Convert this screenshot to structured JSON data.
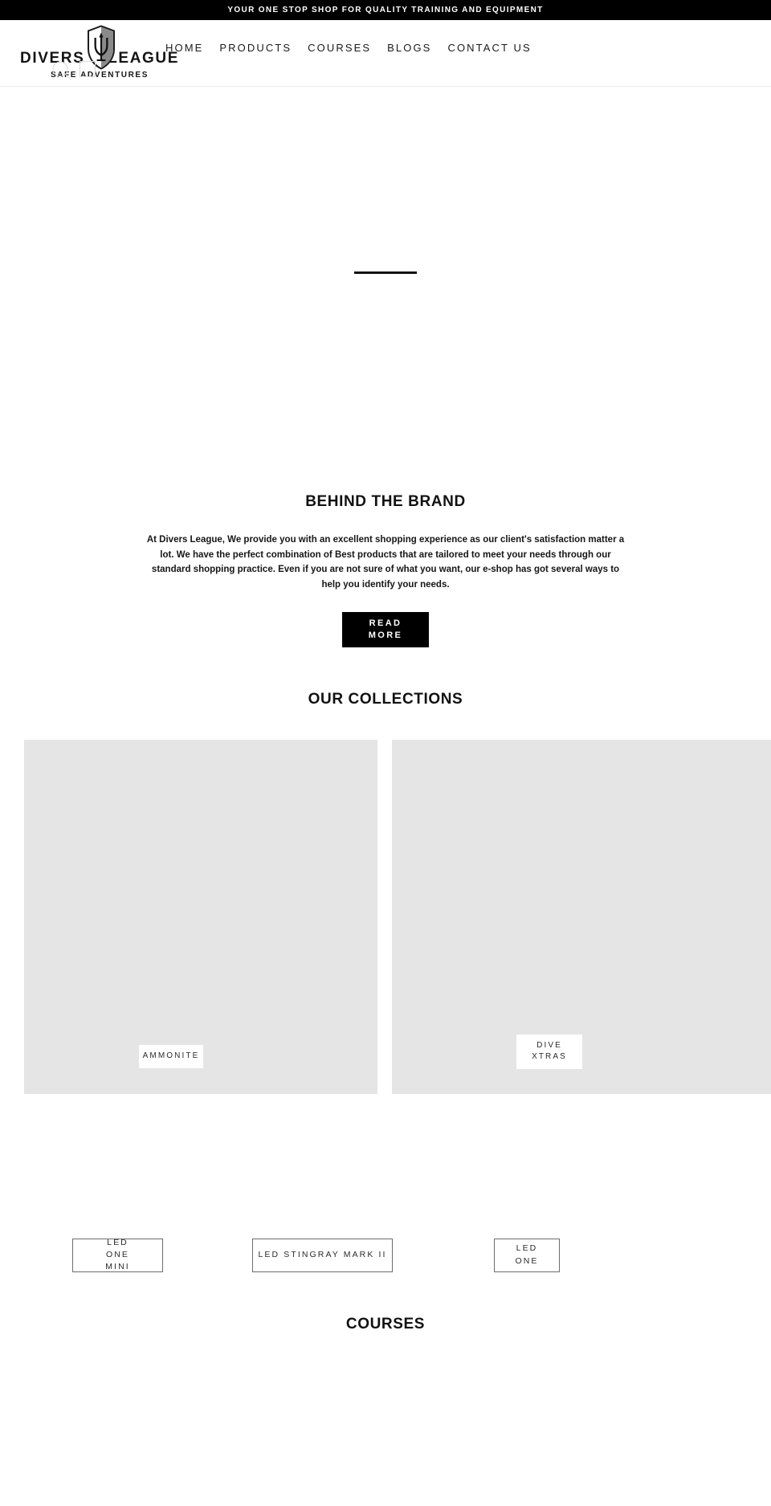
{
  "announcement": {
    "text": "YOUR ONE STOP SHOP FOR QUALITY TRAINING AND EQUIPMENT",
    "background": "#000000",
    "color": "#ffffff"
  },
  "header": {
    "logo": {
      "word_left": "DIVERS",
      "word_right": "LEAGUE",
      "tagline": "SAFE ADVENTURES",
      "emblem": "shield-trident-icon"
    },
    "nav": [
      {
        "label": "HOME"
      },
      {
        "label": "PRODUCTS"
      },
      {
        "label": "COURSES"
      },
      {
        "label": "BLOGS"
      },
      {
        "label": "CONTACT US"
      }
    ]
  },
  "hero": {
    "divider_color": "#111111"
  },
  "brand_section": {
    "heading": "BEHIND THE BRAND",
    "paragraph": "At Divers League, We provide you with an excellent shopping experience as our client's satisfaction matter a lot. We have the perfect combination of Best products that are tailored to meet your needs through our standard shopping practice. Even if you are not sure of what you want, our e-shop has got several ways to help you identify your needs.",
    "read_more_label": "READ MORE",
    "read_more_background": "#000000",
    "read_more_color": "#ffffff"
  },
  "collections": {
    "heading": "OUR COLLECTIONS",
    "placeholder_color": "#e5e5e5",
    "items": [
      {
        "label": "AMMONITE"
      },
      {
        "label": "DIVE XTRAS"
      }
    ]
  },
  "products": {
    "items": [
      {
        "label": "LED ONE MINI"
      },
      {
        "label": "LED STINGRAY MARK II"
      },
      {
        "label": "LED ONE"
      }
    ]
  },
  "courses": {
    "heading": "COURSES"
  }
}
